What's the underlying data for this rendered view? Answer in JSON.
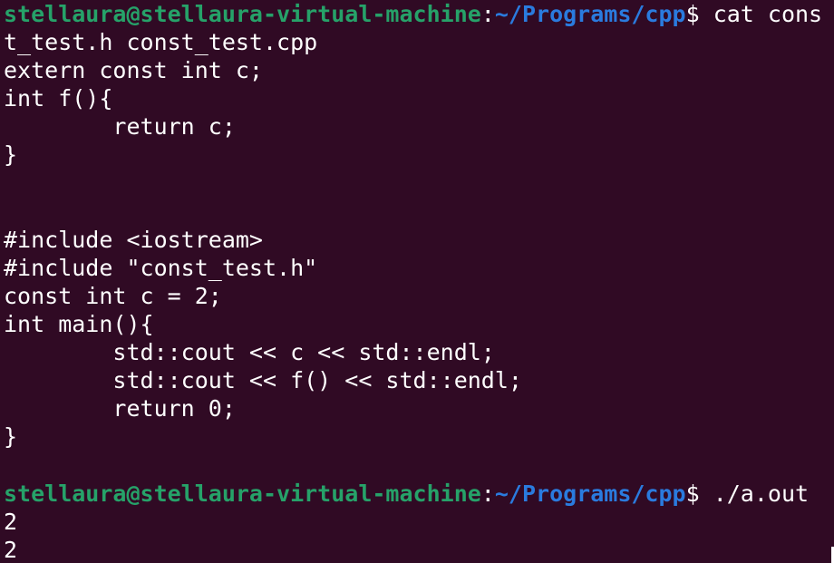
{
  "colors": {
    "background": "#300a24",
    "foreground": "#ffffff",
    "prompt_user": "#26a269",
    "prompt_path": "#2a7bde"
  },
  "prompt1": {
    "user_host": "stellaura@stellaura-virtual-machine",
    "colon": ":",
    "path": "~/Programs/cpp",
    "dollar": "$",
    "command_part1": " cat cons",
    "command_part2": "t_test.h const_test.cpp"
  },
  "header_file": {
    "lines": [
      "extern const int c;",
      "int f(){",
      "        return c;",
      "}",
      "",
      ""
    ]
  },
  "cpp_file": {
    "lines": [
      "#include <iostream>",
      "#include \"const_test.h\"",
      "const int c = 2;",
      "int main(){",
      "        std::cout << c << std::endl;",
      "        std::cout << f() << std::endl;",
      "        return 0;",
      "}",
      ""
    ]
  },
  "prompt2": {
    "user_host": "stellaura@stellaura-virtual-machine",
    "colon": ":",
    "path": "~/Programs/cpp",
    "dollar": "$",
    "command": " ./a.out"
  },
  "output": {
    "lines": [
      "2",
      "2"
    ]
  }
}
